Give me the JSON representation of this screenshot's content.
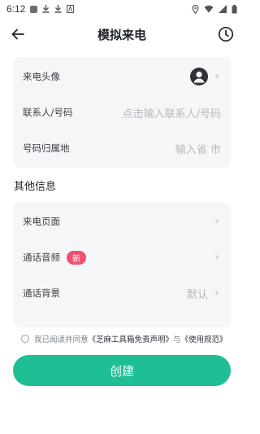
{
  "status_bar": {
    "time": "6:12"
  },
  "header": {
    "title": "模拟来电"
  },
  "caller_card": {
    "avatar_label": "来电头像",
    "contact_label": "联系人/号码",
    "contact_placeholder": "点击输入联系人/号码",
    "location_label": "号码归属地",
    "location_placeholder": "输入省 市"
  },
  "other_section": {
    "title": "其他信息",
    "page_label": "来电页面",
    "audio_label": "通话音频",
    "audio_badge": "新",
    "background_label": "通话背景",
    "background_value": "默认"
  },
  "agreement": {
    "prefix": "我已阅读并同意",
    "disclaimer_link": "《芝麻工具箱免责声明》",
    "and": "与",
    "rules_link": "《使用规范》"
  },
  "create_button": "创建",
  "colors": {
    "primary": "#1fbe94",
    "badge": "#f0506e",
    "card_bg": "#f5f6f8"
  }
}
